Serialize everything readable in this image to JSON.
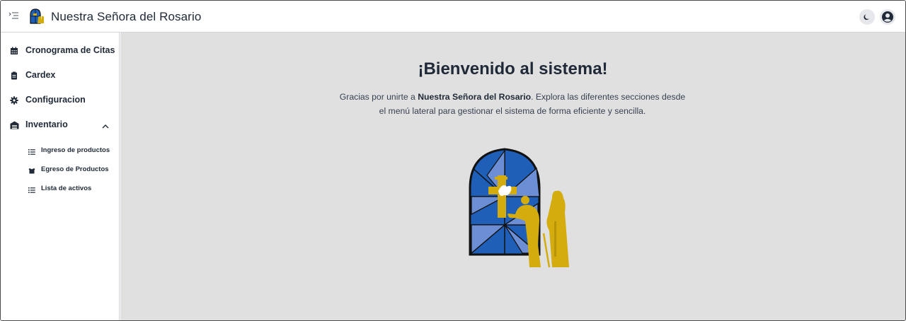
{
  "app": {
    "title": "Nuestra Señora del Rosario"
  },
  "header": {
    "menu_icon": "sidebar-collapse-icon",
    "theme_icon": "moon-icon",
    "user_icon": "user-circle-icon"
  },
  "sidebar": {
    "items": [
      {
        "label": "Cronograma de Citas",
        "icon": "calendar-icon"
      },
      {
        "label": "Cardex",
        "icon": "clipboard-icon"
      },
      {
        "label": "Configuracion",
        "icon": "gear-icon"
      },
      {
        "label": "Inventario",
        "icon": "warehouse-icon",
        "expanded": true
      }
    ],
    "subitems": [
      {
        "label": "Ingreso de productos",
        "icon": "list-icon"
      },
      {
        "label": "Egreso de Productos",
        "icon": "box-icon"
      },
      {
        "label": "Lista de activos",
        "icon": "list-icon"
      }
    ]
  },
  "main": {
    "title": "¡Bienvenido al sistema!",
    "text_before": "Gracias por unirte a ",
    "text_bold": "Nuestra Señora del Rosario",
    "text_after": ". Explora las diferentes secciones desde el menú lateral para gestionar el sistema de forma eficiente y sencilla."
  },
  "colors": {
    "main_bg": "#e0e0e0",
    "window_blue": "#1f5fb8",
    "window_light_blue": "#6b8ed4",
    "figure_gold": "#d4ac0d"
  }
}
